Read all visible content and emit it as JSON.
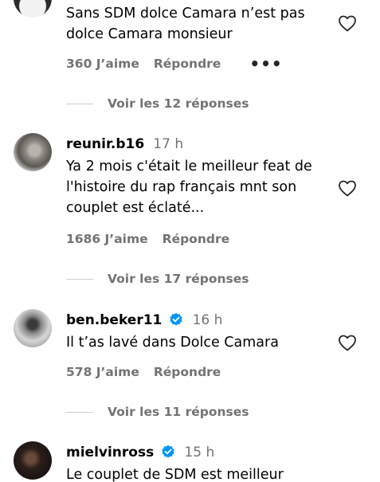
{
  "comments": [
    {
      "text": "Sans SDM dolce Camara n’est pas dolce Camara monsieur",
      "likes": "360 J’aime",
      "reply": "Répondre",
      "more": "•••",
      "replies": "Voir les 12 réponses"
    },
    {
      "username": "reunir.b16",
      "time": "17 h",
      "text": "Ya 2 mois c'était le meilleur feat de l'histoire du rap français mnt son couplet est éclaté...",
      "likes": "1686 J’aime",
      "reply": "Répondre",
      "replies": "Voir les 17 réponses"
    },
    {
      "username": "ben.beker11",
      "time": "16 h",
      "verified": true,
      "text": "Il t’as lavé dans Dolce Camara",
      "likes": "578 J’aime",
      "reply": "Répondre",
      "replies": "Voir les 11 réponses"
    },
    {
      "username": "mielvinross",
      "time": "15 h",
      "verified": true,
      "text": "Le couplet de SDM est meilleur"
    }
  ],
  "colors": {
    "secondary_text": "#737373",
    "verified_blue": "#0095f6",
    "divider": "#cfcfcf"
  }
}
